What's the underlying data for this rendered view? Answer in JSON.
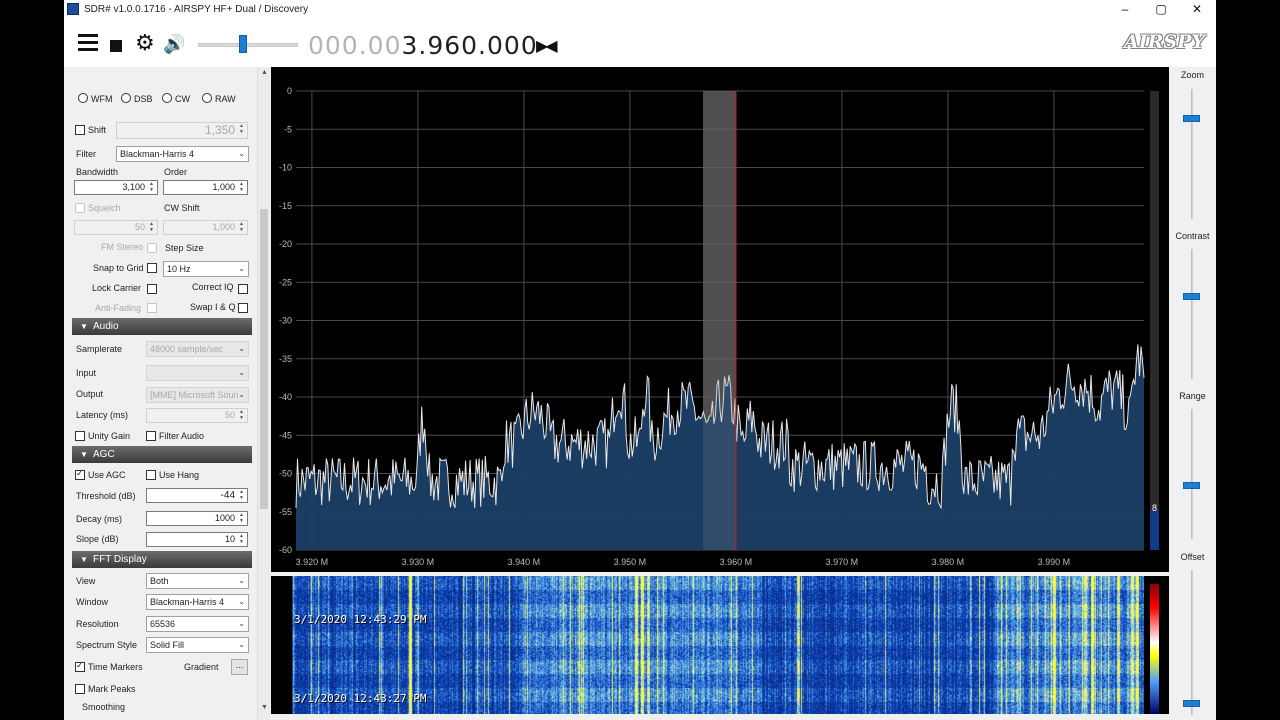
{
  "window": {
    "title": "SDR# v1.0.0.1716 - AIRSPY HF+ Dual / Discovery",
    "min_glyph": "–",
    "max_glyph": "▢",
    "close_glyph": "✕"
  },
  "toolbar": {
    "menu_icon": "hamburger-icon",
    "stop_icon": "stop-icon",
    "settings_icon": "gear-icon",
    "gear_glyph": "⚙",
    "volume_glyph": "🔊",
    "volume_level": 0.45,
    "frequency_dim": "000.003",
    "frequency_bright": ".960.000",
    "frequency_bright_prefix": "",
    "step_glyph": "▶◀",
    "logo": "AIRSPY",
    "accent": "#1d7fd4"
  },
  "radio": {
    "modes": [
      "WFM",
      "DSB",
      "CW",
      "RAW"
    ],
    "shift_label": "Shift",
    "shift_value": "1,350",
    "filter_label": "Filter",
    "filter_value": "Blackman-Harris 4",
    "bandwidth_label": "Bandwidth",
    "bandwidth_value": "3,100",
    "order_label": "Order",
    "order_value": "1,000",
    "squelch_label": "Squelch",
    "squelch_value": "50",
    "cw_shift_label": "CW Shift",
    "cw_shift_value": "1,000",
    "fm_stereo_label": "FM Stereo",
    "step_size_label": "Step Size",
    "snap_label": "Snap to Grid",
    "step_size_value": "10 Hz",
    "lock_carrier_label": "Lock Carrier",
    "correct_iq_label": "Correct IQ",
    "anti_fading_label": "Anti-Fading",
    "swap_iq_label": "Swap I & Q"
  },
  "audio": {
    "header": "Audio",
    "samplerate_label": "Samplerate",
    "samplerate_value": "48000 sample/sec",
    "input_label": "Input",
    "input_value": "",
    "output_label": "Output",
    "output_value": "[MME] Microsoft Soun",
    "latency_label": "Latency (ms)",
    "latency_value": "50",
    "unity_gain_label": "Unity Gain",
    "filter_audio_label": "Filter Audio"
  },
  "agc": {
    "header": "AGC",
    "use_agc_label": "Use AGC",
    "use_hang_label": "Use Hang",
    "threshold_label": "Threshold (dB)",
    "threshold_value": "-44",
    "decay_label": "Decay (ms)",
    "decay_value": "1000",
    "slope_label": "Slope (dB)",
    "slope_value": "10"
  },
  "fft": {
    "header": "FFT Display",
    "view_label": "View",
    "view_value": "Both",
    "window_label": "Window",
    "window_value": "Blackman-Harris 4",
    "resolution_label": "Resolution",
    "resolution_value": "65536",
    "spectrum_style_label": "Spectrum Style",
    "spectrum_style_value": "Solid Fill",
    "time_markers_label": "Time Markers",
    "gradient_label": "Gradient",
    "gradient_button": "...",
    "mark_peaks_label": "Mark Peaks",
    "smoothing_label": "Smoothing"
  },
  "spectrum": {
    "y_ticks": [
      "0",
      "-5",
      "-10",
      "-15",
      "-20",
      "-25",
      "-30",
      "-35",
      "-40",
      "-45",
      "-50",
      "-55",
      "-60"
    ],
    "x_ticks": [
      "3.920 M",
      "3.930 M",
      "3.940 M",
      "3.950 M",
      "3.960 M",
      "3.970 M",
      "3.980 M",
      "3.990 M"
    ],
    "x_range_mhz": [
      3.9185,
      3.9985
    ],
    "y_range_db": [
      -60,
      0
    ],
    "center_mhz": 3.96,
    "filter_band_mhz": [
      3.9569,
      3.96
    ],
    "level_label": "8",
    "fill_color": "#1c3f66",
    "line_color": "#e8e8e8",
    "marker_color": "#d01818"
  },
  "waterfall": {
    "time_top": "3/1/2020 12:43:29 PM",
    "time_bottom": "3/1/2020 12:43:27 PM"
  },
  "sliders": {
    "zoom_label": "Zoom",
    "contrast_label": "Contrast",
    "range_label": "Range",
    "offset_label": "Offset",
    "zoom_level": 0.2,
    "contrast_level": 0.2,
    "range_level": 0.3,
    "offset_level": 0.95
  }
}
